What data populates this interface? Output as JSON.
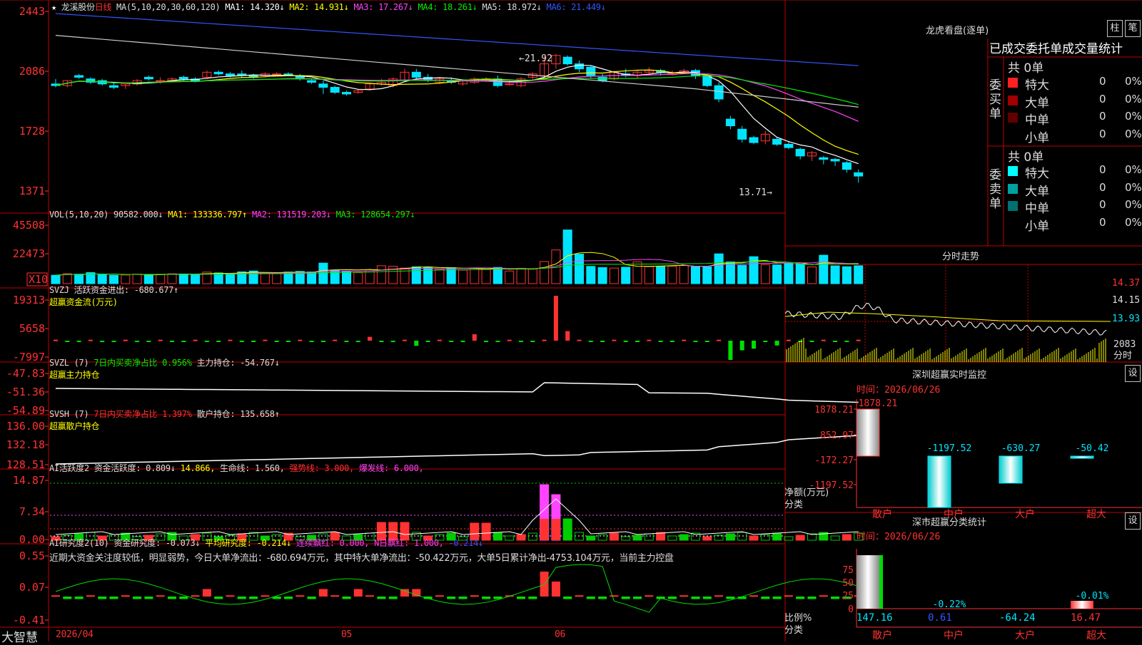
{
  "app": {
    "name": "大智慧",
    "star": "★"
  },
  "stock": {
    "name": "龙溪股份",
    "period": "日线"
  },
  "colors": {
    "up": "#ff3232",
    "down": "#00e5ff",
    "ma1": "#ffffff",
    "ma2": "#ffff00",
    "ma3": "#ff44ff",
    "ma4": "#00ee00",
    "ma5": "#cccccc",
    "ma6": "#3355ff",
    "grid": "#b00000"
  },
  "panels": {
    "price": {
      "label": "MA(5,10,20,30,60,120)",
      "items": [
        {
          "name": "MA1:",
          "value": "14.320",
          "arrow": "↓",
          "color": "#ffffff"
        },
        {
          "name": "MA2:",
          "value": "14.931",
          "arrow": "↓",
          "color": "#ffff00"
        },
        {
          "name": "MA3:",
          "value": "17.267",
          "arrow": "↓",
          "color": "#ff44ff"
        },
        {
          "name": "MA4:",
          "value": "18.261",
          "arrow": "↓",
          "color": "#00ee00"
        },
        {
          "name": "MA5:",
          "value": "18.972",
          "arrow": "↓",
          "color": "#dddddd"
        },
        {
          "name": "MA6:",
          "value": "21.449",
          "arrow": "↓",
          "color": "#3355ff"
        }
      ],
      "yticks": [
        "2443",
        "2086",
        "1728",
        "1371"
      ],
      "high_note": "21.92",
      "low_note": "13.71"
    },
    "vol": {
      "label": "VOL(5,10,20)",
      "items": [
        {
          "name": "",
          "value": "90582.000",
          "arrow": "↓",
          "color": "#dddddd"
        },
        {
          "name": "MA1:",
          "value": "133336.797",
          "arrow": "↑",
          "color": "#ffff00"
        },
        {
          "name": "MA2:",
          "value": "131519.203",
          "arrow": "↓",
          "color": "#ff44ff"
        },
        {
          "name": "MA3:",
          "value": "128654.297",
          "arrow": "↓",
          "color": "#00ee00"
        }
      ],
      "yticks": [
        "45508",
        "22473"
      ],
      "unit": "X10"
    },
    "svzj": {
      "label": "SVZJ",
      "items": [
        {
          "name": "活跃资金进出:",
          "value": "-680.677",
          "arrow": "↑",
          "color": "#dddddd"
        }
      ],
      "title2": "超赢资金流(万元)",
      "yticks": [
        "19313",
        "5658",
        "-7997"
      ]
    },
    "svzl": {
      "label": "SVZL  (7)",
      "items": [
        {
          "name": "7日内买卖净占比",
          "value": "0.956%",
          "arrow": "",
          "color": "#00ee00"
        },
        {
          "name": "主力持仓:",
          "value": "-54.767",
          "arrow": "↓",
          "color": "#dddddd"
        }
      ],
      "title2": "超赢主力持仓",
      "yticks": [
        "-47.83",
        "-51.36",
        "-54.89"
      ]
    },
    "svsh": {
      "label": "SVSH  (7)",
      "items": [
        {
          "name": "7日内买卖净占比",
          "value": "1.397%",
          "arrow": "",
          "color": "#ff3232"
        },
        {
          "name": "散户持仓:",
          "value": "135.658",
          "arrow": "↑",
          "color": "#dddddd"
        }
      ],
      "title2": "超赢散户持仓",
      "yticks": [
        "136.00",
        "132.18",
        "128.51"
      ]
    },
    "ai1": {
      "label": "AI活跃度2",
      "items": [
        {
          "name": "资金活跃度:",
          "value": "0.809",
          "arrow": "↓",
          "color": "#dddddd"
        },
        {
          "name": "",
          "value": "14.866",
          "arrow": ",",
          "color": "#ffff00"
        },
        {
          "name": "生命线:",
          "value": "1.560",
          "arrow": ",",
          "color": "#dddddd"
        },
        {
          "name": "强势线:",
          "value": "3.000",
          "arrow": ",",
          "color": "#ff3232"
        },
        {
          "name": "爆发线:",
          "value": "6.000",
          "arrow": ",",
          "color": "#ff44ff"
        }
      ],
      "yticks": [
        "14.87",
        "7.34",
        "0.00"
      ]
    },
    "ai2": {
      "label": "AI研究度2(10)",
      "items": [
        {
          "name": "资金研究度:",
          "value": "-0.073",
          "arrow": "↓",
          "color": "#dddddd"
        },
        {
          "name": "平均研究度:",
          "value": "-0.214",
          "arrow": "↓",
          "color": "#ffff00"
        },
        {
          "name": "连续飘红:",
          "value": "0.000",
          "arrow": ",",
          "color": "#ff44ff"
        },
        {
          "name": "N日飘红:",
          "value": "1.000",
          "arrow": ",",
          "color": "#ff44ff"
        },
        {
          "name": "",
          "value": "-0.214",
          "arrow": "↓",
          "color": "#3355ff"
        }
      ],
      "yticks": [
        "0.55",
        "0.07",
        "-0.41"
      ],
      "comment": "近期大资金关注度较低，明显弱势，今日大单净流出：-680.694万元，其中特大单净流出：-50.422万元，大单5日累计净出-4753.104万元，当前主力控盘"
    }
  },
  "dates": [
    "2026/04",
    "05",
    "06"
  ],
  "right": {
    "lhkp": {
      "title": "龙虎看盘(逐单)",
      "btn1": "柱",
      "btn2": "笔",
      "stat_title": "已成交委托单成交量统计",
      "buy": {
        "side": "委买单",
        "total": "共 0单",
        "rows": [
          {
            "label": "特大",
            "value": "0",
            "pct": "0%",
            "color": "#ff2020"
          },
          {
            "label": "大单",
            "value": "0",
            "pct": "0%",
            "color": "#a00000"
          },
          {
            "label": "中单",
            "value": "0",
            "pct": "0%",
            "color": "#600000"
          },
          {
            "label": "小单",
            "value": "0",
            "pct": "0%",
            "color": ""
          }
        ]
      },
      "sell": {
        "side": "委卖单",
        "total": "共 0单",
        "rows": [
          {
            "label": "特大",
            "value": "0",
            "pct": "0%",
            "color": "#00ffff"
          },
          {
            "label": "大单",
            "value": "0",
            "pct": "0%",
            "color": "#00a0a0"
          },
          {
            "label": "中单",
            "value": "0",
            "pct": "0%",
            "color": "#007070"
          },
          {
            "label": "小单",
            "value": "0",
            "pct": "0%",
            "color": ""
          }
        ]
      }
    },
    "intraday": {
      "title": "分时走势",
      "yticks": [
        "14.37",
        "14.15",
        "13.93"
      ],
      "vol": "2083",
      "vol_label": "分时"
    },
    "monitor": {
      "title": "深圳超赢实时监控",
      "btn": "设",
      "time_label": "时间：2026/06/26",
      "yticks": [
        "1878.21",
        "852.97",
        "-172.27",
        "-1197.52"
      ],
      "ylabel1": "净额(万元)",
      "ylabel2": "分类",
      "cats": [
        "散户",
        "中户",
        "大户",
        "超大"
      ],
      "values": [
        1878.21,
        -1197.52,
        -630.27,
        -50.42
      ],
      "labels": [
        "1878.21",
        "-1197.52",
        "-630.27",
        "-50.42"
      ]
    },
    "stats": {
      "title": "深市超赢分类统计",
      "btn": "设",
      "time_label": "时间：2026/06/26",
      "yticks": [
        "75",
        "50",
        "25",
        "0"
      ],
      "ylabel1": "比例%",
      "ylabel2": "分类",
      "cats": [
        "散户",
        "中户",
        "大户",
        "超大"
      ],
      "pcts": [
        147.16,
        0.61,
        -64.24,
        16.47
      ],
      "labels": [
        "147.16",
        "0.61",
        "-64.24",
        "16.47"
      ],
      "notes": [
        "",
        "-0.22%",
        "",
        "-0.01%"
      ]
    }
  },
  "chart_data": [
    {
      "type": "candlestick",
      "title": "龙溪股份 日线",
      "ylim": [
        13.5,
        24.6
      ],
      "x": [
        "2026/04",
        "05",
        "06"
      ],
      "ohlc": [
        [
          20.1,
          20.4,
          19.9,
          20.0
        ],
        [
          20.0,
          20.3,
          19.9,
          20.3
        ],
        [
          20.6,
          20.7,
          20.4,
          20.5
        ],
        [
          20.4,
          20.5,
          20.1,
          20.2
        ],
        [
          20.3,
          20.4,
          20.0,
          20.1
        ],
        [
          20.0,
          20.2,
          19.8,
          19.9
        ],
        [
          20.0,
          20.1,
          19.8,
          20.1
        ],
        [
          20.1,
          20.4,
          20.0,
          20.3
        ],
        [
          20.5,
          20.6,
          20.3,
          20.4
        ],
        [
          20.3,
          20.5,
          20.1,
          20.3
        ],
        [
          20.3,
          20.5,
          20.2,
          20.4
        ],
        [
          20.5,
          20.6,
          20.3,
          20.4
        ],
        [
          20.4,
          20.5,
          20.2,
          20.3
        ],
        [
          20.5,
          20.9,
          20.4,
          20.8
        ],
        [
          20.8,
          20.9,
          20.6,
          20.7
        ],
        [
          20.7,
          20.8,
          20.5,
          20.6
        ],
        [
          20.7,
          20.9,
          20.5,
          20.6
        ],
        [
          20.6,
          20.7,
          20.4,
          20.5
        ],
        [
          20.6,
          20.8,
          20.5,
          20.7
        ],
        [
          20.7,
          20.8,
          20.6,
          20.7
        ],
        [
          20.7,
          20.8,
          20.6,
          20.6
        ],
        [
          20.6,
          20.7,
          20.3,
          20.4
        ],
        [
          20.3,
          20.4,
          20.1,
          20.2
        ],
        [
          20.1,
          20.3,
          19.5,
          19.9
        ],
        [
          19.9,
          20.0,
          19.5,
          19.6
        ],
        [
          19.6,
          19.7,
          19.4,
          19.5
        ],
        [
          19.6,
          19.8,
          19.5,
          19.7
        ],
        [
          19.8,
          20.2,
          19.7,
          20.1
        ],
        [
          20.1,
          20.4,
          20.0,
          20.2
        ],
        [
          20.0,
          20.5,
          19.9,
          20.4
        ],
        [
          20.3,
          21.0,
          20.2,
          20.8
        ],
        [
          20.8,
          21.0,
          20.4,
          20.5
        ],
        [
          20.5,
          20.7,
          20.2,
          20.3
        ],
        [
          20.2,
          20.5,
          20.1,
          20.4
        ],
        [
          20.3,
          20.5,
          20.1,
          20.2
        ],
        [
          20.1,
          20.4,
          20.0,
          20.3
        ],
        [
          20.2,
          20.5,
          20.1,
          20.4
        ],
        [
          20.3,
          20.5,
          20.2,
          20.4
        ],
        [
          20.4,
          20.6,
          19.9,
          20.0
        ],
        [
          20.1,
          20.3,
          20.0,
          20.1
        ],
        [
          20.0,
          20.5,
          19.9,
          20.4
        ],
        [
          20.5,
          20.8,
          20.3,
          20.7
        ],
        [
          20.6,
          21.8,
          20.5,
          21.3
        ],
        [
          21.3,
          21.9,
          21.0,
          21.8
        ],
        [
          21.7,
          21.8,
          21.2,
          21.3
        ],
        [
          21.3,
          21.5,
          20.8,
          21.0
        ],
        [
          21.1,
          21.2,
          20.4,
          20.6
        ],
        [
          20.5,
          20.7,
          20.2,
          20.3
        ],
        [
          20.4,
          20.9,
          20.3,
          20.8
        ],
        [
          20.7,
          21.0,
          20.5,
          20.6
        ],
        [
          20.6,
          20.9,
          20.4,
          20.8
        ],
        [
          20.8,
          21.1,
          20.7,
          20.9
        ],
        [
          20.9,
          21.0,
          20.6,
          20.8
        ],
        [
          20.7,
          20.9,
          20.6,
          20.7
        ],
        [
          20.8,
          21.0,
          20.7,
          20.9
        ],
        [
          20.9,
          21.0,
          20.4,
          20.6
        ],
        [
          20.6,
          20.7,
          19.9,
          20.0
        ],
        [
          20.0,
          20.2,
          19.0,
          19.2
        ],
        [
          18.0,
          18.2,
          17.4,
          17.6
        ],
        [
          17.4,
          17.6,
          16.6,
          16.8
        ],
        [
          16.9,
          17.0,
          16.5,
          16.6
        ],
        [
          16.7,
          17.3,
          16.5,
          17.1
        ],
        [
          16.8,
          16.9,
          16.4,
          16.5
        ],
        [
          16.5,
          16.7,
          16.2,
          16.3
        ],
        [
          16.2,
          16.3,
          15.6,
          15.8
        ],
        [
          15.8,
          16.1,
          15.5,
          16.0
        ],
        [
          15.7,
          15.8,
          15.3,
          15.6
        ],
        [
          15.6,
          15.7,
          15.2,
          15.5
        ],
        [
          15.4,
          15.5,
          14.8,
          15.0
        ],
        [
          14.8,
          15.0,
          14.2,
          14.6
        ]
      ]
    },
    {
      "type": "bar",
      "title": "VOL(5,10,20)",
      "ylim": [
        0,
        60000
      ],
      "values": [
        8000,
        9500,
        9000,
        10500,
        8500,
        7800,
        8200,
        9100,
        8800,
        9000,
        9400,
        9200,
        8700,
        11000,
        10200,
        9800,
        11200,
        12000,
        10000,
        9500,
        11000,
        11600,
        11100,
        19500,
        12500,
        11800,
        10400,
        13200,
        17000,
        16500,
        14800,
        16000,
        15600,
        13800,
        15200,
        12900,
        14700,
        13500,
        15400,
        12000,
        14600,
        13800,
        21000,
        32000,
        51000,
        28000,
        16400,
        15300,
        14800,
        15600,
        20700,
        16100,
        16500,
        16600,
        17200,
        16100,
        15900,
        28300,
        20700,
        17400,
        25600,
        18100,
        17800,
        19100,
        18600,
        15900,
        27000,
        16900,
        16100,
        17000
      ]
    }
  ]
}
